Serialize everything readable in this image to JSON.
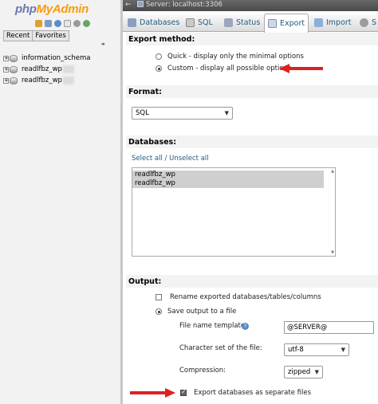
{
  "nav": {
    "logo_php": "php",
    "logo_myadmin": "MyAdmin",
    "tabs": [
      "Recent",
      "Favorites"
    ],
    "databases": [
      "information_schema",
      "readlfbz_wp",
      "readlfbz_wp"
    ],
    "expander": "+"
  },
  "topbar": {
    "back": "←",
    "server": "Server: localhost:3306"
  },
  "menu": [
    {
      "label": "Databases",
      "icon": "databases-icon",
      "color": "#8a9fbf"
    },
    {
      "label": "SQL",
      "icon": "sql-icon",
      "color": "#c9c9c9"
    },
    {
      "label": "Status",
      "icon": "status-icon",
      "color": "#9aa7bd"
    },
    {
      "label": "Export",
      "icon": "export-icon",
      "color": "#cfd7e6",
      "active": true
    },
    {
      "label": "Import",
      "icon": "import-icon",
      "color": "#8ab0d6"
    },
    {
      "label": "S",
      "icon": "settings-icon",
      "color": "#9c9c9c"
    }
  ],
  "export_method": {
    "heading": "Export method:",
    "quick": "Quick - display only the minimal options",
    "custom": "Custom - display all possible options",
    "selected": "custom"
  },
  "format": {
    "heading": "Format:",
    "value": "SQL"
  },
  "databases": {
    "heading": "Databases:",
    "select_all": "Select all",
    "separator": " / ",
    "unselect_all": "Unselect all",
    "items": [
      "readlfbz_wp",
      "readlfbz_wp"
    ]
  },
  "output": {
    "heading": "Output:",
    "rename": "Rename exported databases/tables/columns",
    "save_to_file": "Save output to a file",
    "file_name_template_label": "File name template:",
    "file_name_template_value": "@SERVER@",
    "charset_label": "Character set of the file:",
    "charset_value": "utf-8",
    "compression_label": "Compression:",
    "compression_value": "zipped",
    "separate_files": "Export databases as separate files"
  },
  "colors": {
    "accent_link": "#235a81",
    "annotation_arrow": "#e02020",
    "logo_php": "#6c78af",
    "logo_myadmin": "#f89c0e"
  }
}
